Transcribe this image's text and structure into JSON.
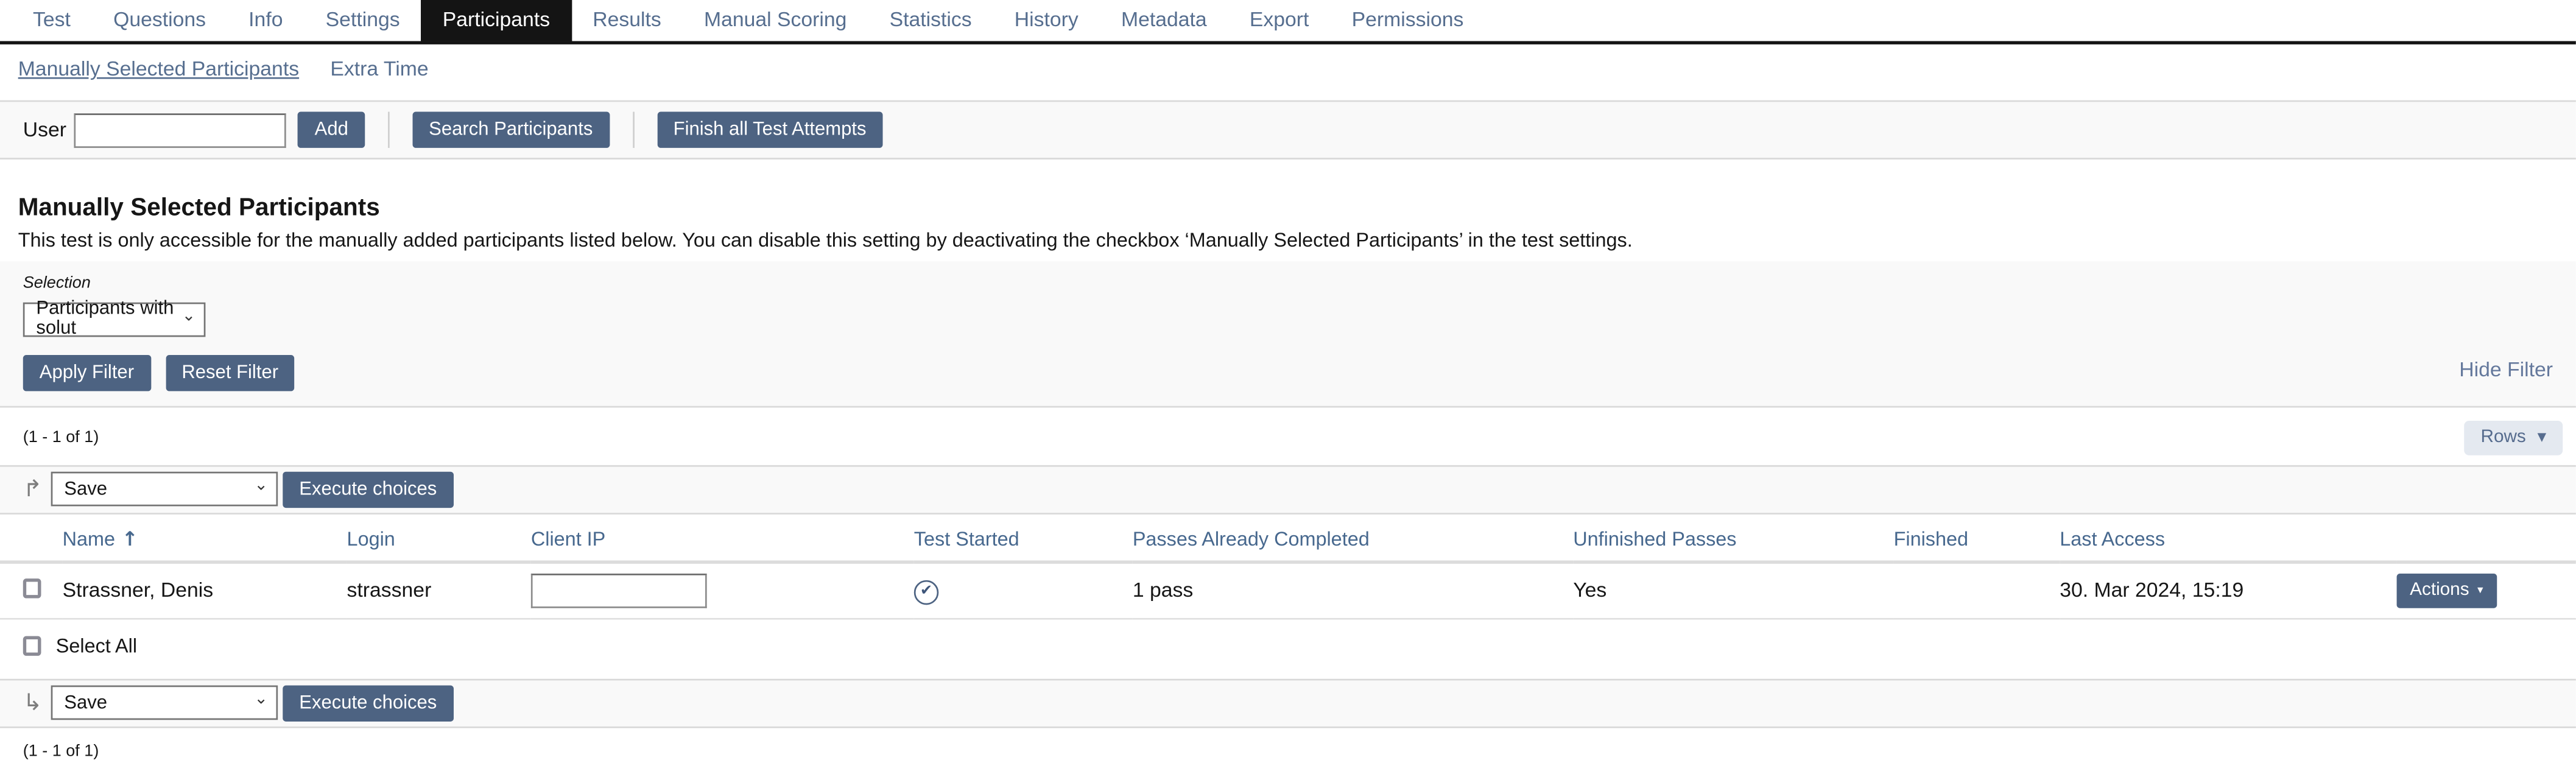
{
  "tabs": [
    {
      "label": "Test",
      "active": false
    },
    {
      "label": "Questions",
      "active": false
    },
    {
      "label": "Info",
      "active": false
    },
    {
      "label": "Settings",
      "active": false
    },
    {
      "label": "Participants",
      "active": true
    },
    {
      "label": "Results",
      "active": false
    },
    {
      "label": "Manual Scoring",
      "active": false
    },
    {
      "label": "Statistics",
      "active": false
    },
    {
      "label": "History",
      "active": false
    },
    {
      "label": "Metadata",
      "active": false
    },
    {
      "label": "Export",
      "active": false
    },
    {
      "label": "Permissions",
      "active": false
    }
  ],
  "subtabs": [
    {
      "label": "Manually Selected Participants",
      "active": true
    },
    {
      "label": "Extra Time",
      "active": false
    }
  ],
  "toolbar": {
    "user_label": "User",
    "user_value": "",
    "add_label": "Add",
    "search_label": "Search Participants",
    "finish_label": "Finish all Test Attempts"
  },
  "main": {
    "title": "Manually Selected Participants",
    "description": "This test is only accessible for the manually added participants listed below. You can disable this setting by deactivating the checkbox ‘Manually Selected Participants’ in the test settings."
  },
  "filter": {
    "selection_label": "Selection",
    "selection_value": "Participants with solut",
    "apply_label": "Apply Filter",
    "reset_label": "Reset Filter",
    "hide_label": "Hide Filter"
  },
  "pagination": {
    "count_top": "(1 - 1 of 1)",
    "count_bottom": "(1 - 1 of 1)",
    "rows_label": "Rows"
  },
  "bulk": {
    "action_value": "Save",
    "execute_label": "Execute choices"
  },
  "table": {
    "headers": [
      "Name",
      "Login",
      "Client IP",
      "Test Started",
      "Passes Already Completed",
      "Unfinished Passes",
      "Finished",
      "Last Access"
    ],
    "sort_column": "Name",
    "sort_direction": "ascending",
    "select_all_label": "Select All",
    "rows": [
      {
        "name": "Strassner, Denis",
        "login": "strassner",
        "client_ip": "",
        "test_started": true,
        "passes_completed": "1 pass",
        "unfinished_passes": "Yes",
        "finished": "",
        "last_access": "30. Mar 2024, 15:19",
        "actions_label": "Actions"
      }
    ]
  },
  "icons": {
    "select_chevron": "⌄",
    "caret_down": "▼",
    "caret_down_small": "▾",
    "sort_asc": "↑",
    "apply_top": "↱",
    "apply_bottom": "↳",
    "check": "✔"
  },
  "colors": {
    "accent_button": "#4d6382",
    "link_text": "#566e8f",
    "active_tab_bg": "#141414",
    "bar_bg": "#f9f9f9"
  }
}
